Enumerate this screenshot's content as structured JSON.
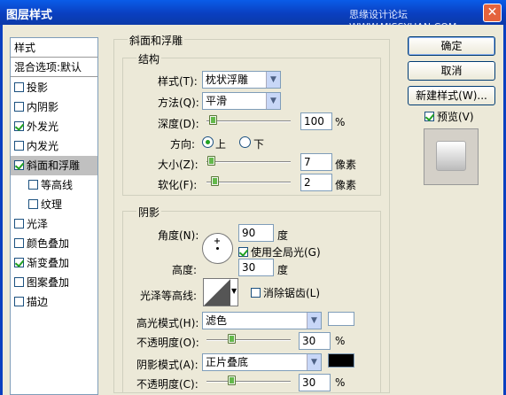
{
  "window": {
    "title": "图层样式",
    "watermark": "思缘设计论坛 WWW.MISSYUAN.COM",
    "close": "✕"
  },
  "left": {
    "items": [
      {
        "label": "样式",
        "checkbox": false,
        "checked": false,
        "selected": false
      },
      {
        "label": "混合选项:默认",
        "checkbox": false,
        "checked": false,
        "selected": false
      },
      {
        "label": "投影",
        "checkbox": true,
        "checked": false,
        "selected": false
      },
      {
        "label": "内阴影",
        "checkbox": true,
        "checked": false,
        "selected": false
      },
      {
        "label": "外发光",
        "checkbox": true,
        "checked": true,
        "selected": false
      },
      {
        "label": "内发光",
        "checkbox": true,
        "checked": false,
        "selected": false
      },
      {
        "label": "斜面和浮雕",
        "checkbox": true,
        "checked": true,
        "selected": true
      },
      {
        "label": "等高线",
        "checkbox": true,
        "checked": false,
        "selected": false
      },
      {
        "label": "纹理",
        "checkbox": true,
        "checked": false,
        "selected": false
      },
      {
        "label": "光泽",
        "checkbox": true,
        "checked": false,
        "selected": false
      },
      {
        "label": "颜色叠加",
        "checkbox": true,
        "checked": false,
        "selected": false
      },
      {
        "label": "渐变叠加",
        "checkbox": true,
        "checked": true,
        "selected": false
      },
      {
        "label": "图案叠加",
        "checkbox": true,
        "checked": false,
        "selected": false
      },
      {
        "label": "描边",
        "checkbox": true,
        "checked": false,
        "selected": false
      }
    ]
  },
  "bevel": {
    "group_title": "斜面和浮雕",
    "structure": {
      "title": "结构",
      "style_label": "样式(T):",
      "style_value": "枕状浮雕",
      "technique_label": "方法(Q):",
      "technique_value": "平滑",
      "depth_label": "深度(D):",
      "depth_value": "100",
      "depth_unit": "%",
      "direction_label": "方向:",
      "dir_up": "上",
      "dir_down": "下",
      "size_label": "大小(Z):",
      "size_value": "7",
      "size_unit": "像素",
      "soften_label": "软化(F):",
      "soften_value": "2",
      "soften_unit": "像素"
    },
    "shading": {
      "title": "阴影",
      "angle_label": "角度(N):",
      "angle_value": "90",
      "angle_unit": "度",
      "global_light_label": "使用全局光(G)",
      "altitude_label": "高度:",
      "altitude_value": "30",
      "altitude_unit": "度",
      "gloss_contour_label": "光泽等高线:",
      "anti_alias_label": "消除锯齿(L)",
      "highlight_mode_label": "高光模式(H):",
      "highlight_mode_value": "滤色",
      "highlight_opacity_label": "不透明度(O):",
      "highlight_opacity_value": "30",
      "highlight_opacity_unit": "%",
      "shadow_mode_label": "阴影模式(A):",
      "shadow_mode_value": "正片叠底",
      "shadow_opacity_label": "不透明度(C):",
      "shadow_opacity_value": "30",
      "shadow_opacity_unit": "%",
      "highlight_color": "#ffffff",
      "shadow_color": "#000000"
    }
  },
  "buttons": {
    "ok": "确定",
    "cancel": "取消",
    "new_style": "新建样式(W)...",
    "preview": "预览(V)"
  }
}
